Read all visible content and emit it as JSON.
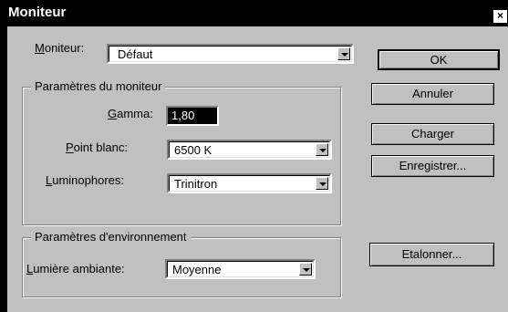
{
  "window": {
    "title": "Moniteur",
    "close_glyph": "×"
  },
  "monitor": {
    "label_u": "M",
    "label_rest": "oniteur:",
    "value": "Défaut"
  },
  "monitor_params": {
    "title": "Paramètres du moniteur",
    "gamma": {
      "label_u": "G",
      "label_rest": "amma:",
      "value": "1,80"
    },
    "white_point": {
      "label_u": "P",
      "label_rest": "oint blanc:",
      "value": "6500 K"
    },
    "phosphors": {
      "label_u": "L",
      "label_rest": "uminophores:",
      "value": "Trinitron"
    }
  },
  "environment_params": {
    "title": "Paramètres d'environnement",
    "ambient_light": {
      "label_u": "L",
      "label_rest": "umière ambiante:",
      "value": "Moyenne"
    }
  },
  "buttons": {
    "ok": "OK",
    "cancel": "Annuler",
    "load": "Charger",
    "save": "Enregistrer...",
    "calibrate": "Etalonner..."
  },
  "icons": {
    "dropdown": "chevron-down-icon",
    "close": "close-icon"
  }
}
